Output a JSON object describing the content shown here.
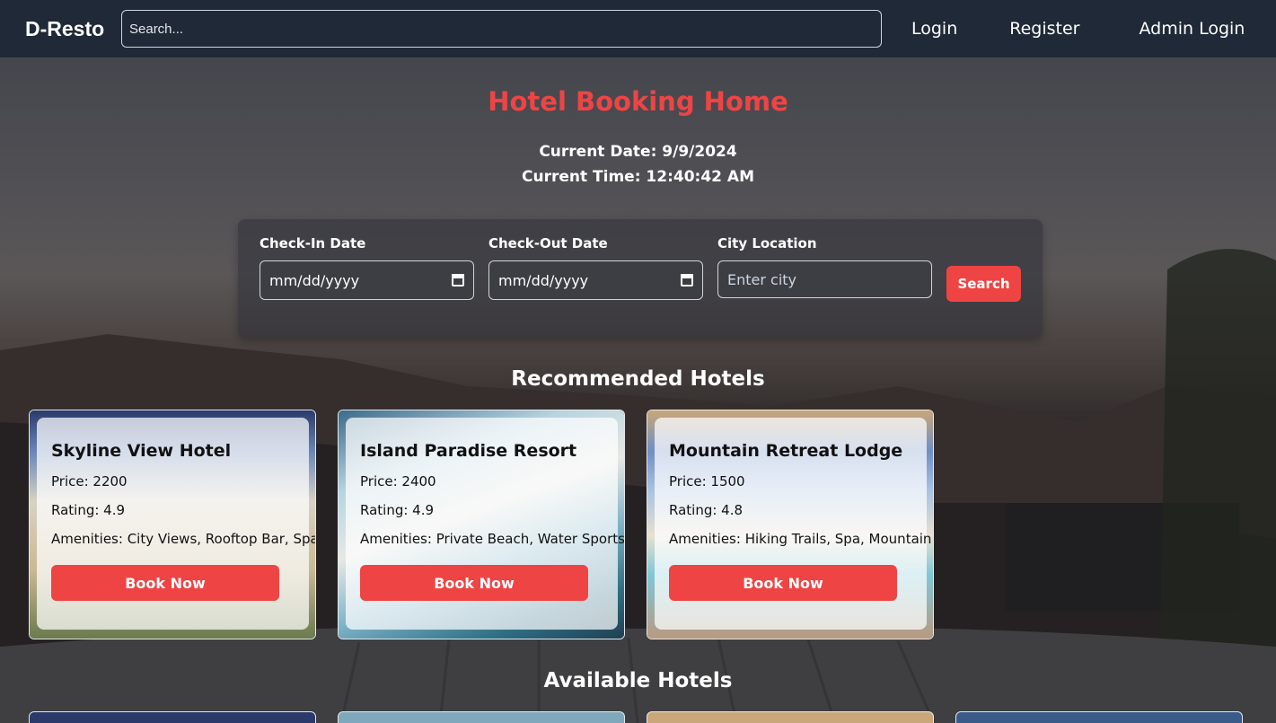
{
  "nav": {
    "brand": "D-Resto",
    "search_placeholder": "Search...",
    "links": [
      "Login",
      "Register",
      "Admin Login"
    ]
  },
  "page": {
    "title": "Hotel Booking Home",
    "current_date": "Current Date: 9/9/2024",
    "current_time": "Current Time: 12:40:42 AM"
  },
  "form": {
    "checkin_label": "Check-In Date",
    "checkin_placeholder": "mm/dd/yyyy",
    "checkout_label": "Check-Out Date",
    "checkout_placeholder": "mm/dd/yyyy",
    "city_label": "City Location",
    "city_placeholder": "Enter city",
    "search_button": "Search"
  },
  "sections": {
    "recommended": "Recommended Hotels",
    "available": "Available Hotels"
  },
  "hotels": [
    {
      "name": "Skyline View Hotel",
      "price": "Price: 2200",
      "rating": "Rating: 4.9",
      "amenities": "Amenities: City Views, Rooftop Bar, Spa",
      "book": "Book Now"
    },
    {
      "name": "Island Paradise Resort",
      "price": "Price: 2400",
      "rating": "Rating: 4.9",
      "amenities": "Amenities: Private Beach, Water Sports, Tours",
      "book": "Book Now"
    },
    {
      "name": "Mountain Retreat Lodge",
      "price": "Price: 1500",
      "rating": "Rating: 4.8",
      "amenities": "Amenities: Hiking Trails, Spa, Mountain Views",
      "book": "Book Now"
    }
  ],
  "colors": {
    "accent": "#ef4444",
    "navbar": "#1f2937"
  }
}
